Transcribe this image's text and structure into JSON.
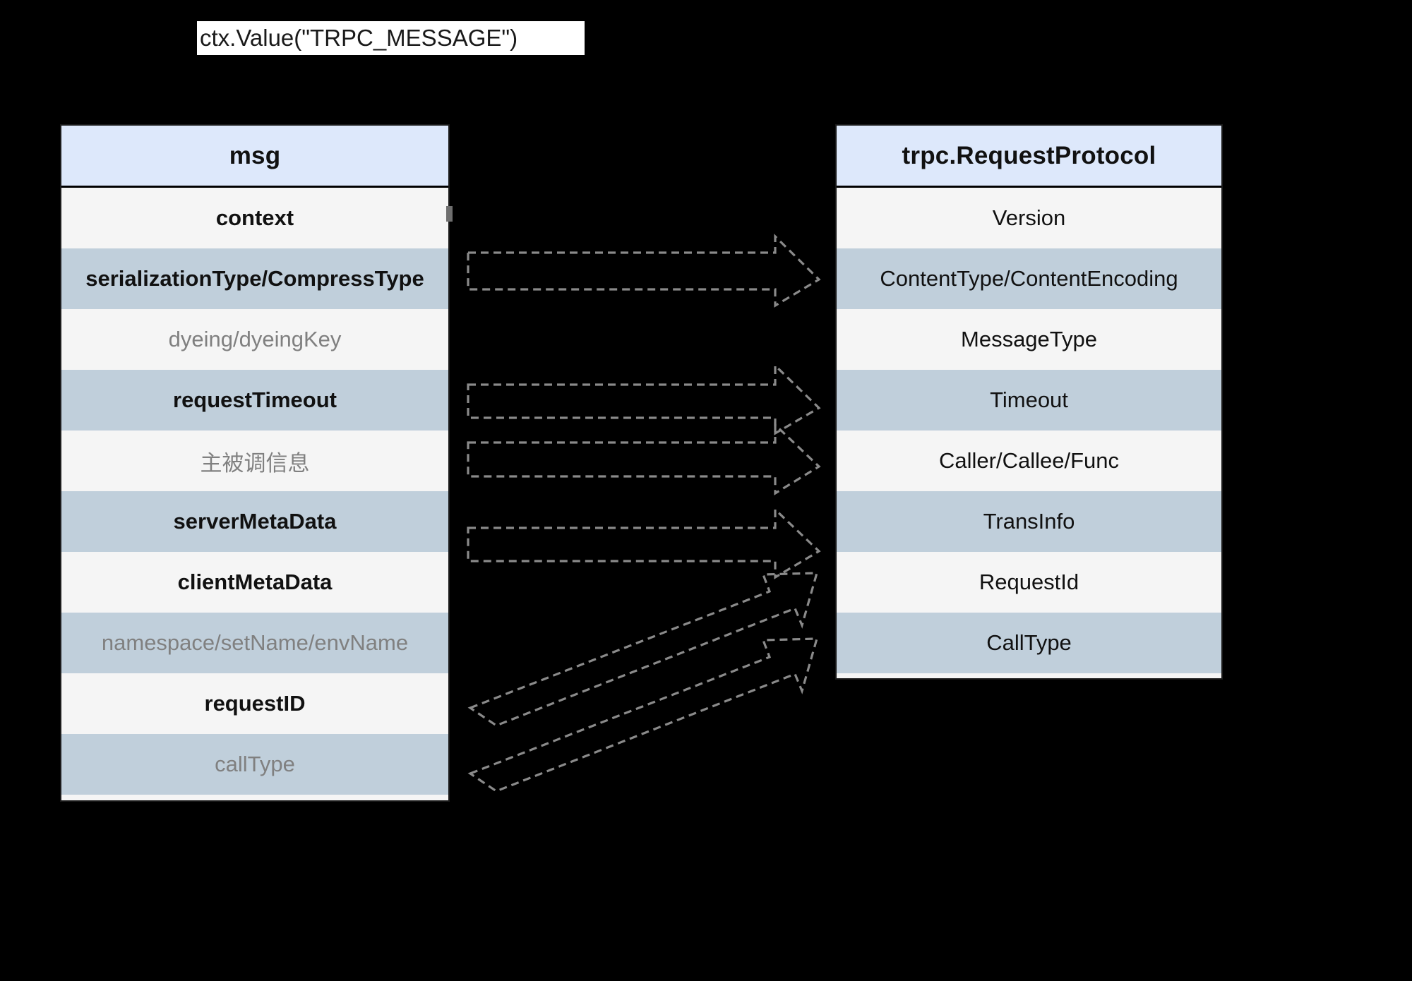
{
  "annotation": {
    "label": "ctx.Value(\"TRPC_MESSAGE\")",
    "connector_icon": "vertical-connector-line"
  },
  "colors": {
    "background": "#000000",
    "header_fill": "#dde8fb",
    "row_light": "#f5f5f5",
    "row_dark": "#c0cfdb",
    "text_strong": "#111111",
    "text_muted": "#808080",
    "border": "#1a1a1a",
    "arrow_stroke": "#8a8a8a"
  },
  "left_table": {
    "title": "msg",
    "rows": [
      {
        "label": "context",
        "emphasis": "strong",
        "shade": "light"
      },
      {
        "label": "serializationType/CompressType",
        "emphasis": "strong",
        "shade": "dark"
      },
      {
        "label": "dyeing/dyeingKey",
        "emphasis": "muted",
        "shade": "light"
      },
      {
        "label": "requestTimeout",
        "emphasis": "strong",
        "shade": "dark"
      },
      {
        "label": "主被调信息",
        "emphasis": "muted",
        "shade": "light"
      },
      {
        "label": "serverMetaData",
        "emphasis": "strong",
        "shade": "dark"
      },
      {
        "label": "clientMetaData",
        "emphasis": "strong",
        "shade": "light"
      },
      {
        "label": "namespace/setName/envName",
        "emphasis": "muted",
        "shade": "dark"
      },
      {
        "label": "requestID",
        "emphasis": "strong",
        "shade": "light"
      },
      {
        "label": "callType",
        "emphasis": "muted",
        "shade": "dark"
      }
    ]
  },
  "right_table": {
    "title": "trpc.RequestProtocol",
    "rows": [
      {
        "label": "Version",
        "emphasis": "plain",
        "shade": "light"
      },
      {
        "label": "ContentType/ContentEncoding",
        "emphasis": "plain",
        "shade": "dark"
      },
      {
        "label": "MessageType",
        "emphasis": "plain",
        "shade": "light"
      },
      {
        "label": "Timeout",
        "emphasis": "plain",
        "shade": "dark"
      },
      {
        "label": "Caller/Callee/Func",
        "emphasis": "plain",
        "shade": "light"
      },
      {
        "label": "TransInfo",
        "emphasis": "plain",
        "shade": "dark"
      },
      {
        "label": "RequestId",
        "emphasis": "plain",
        "shade": "light"
      },
      {
        "label": "CallType",
        "emphasis": "plain",
        "shade": "dark"
      }
    ]
  },
  "mappings": [
    {
      "id": "arrow-serialization-to-contenttype",
      "from": "serializationType/CompressType",
      "to": "ContentType/ContentEncoding"
    },
    {
      "id": "arrow-requesttimeout-to-timeout",
      "from": "requestTimeout",
      "to": "Timeout"
    },
    {
      "id": "arrow-callerinfo-to-callercallee",
      "from": "主被调信息",
      "to": "Caller/Callee/Func"
    },
    {
      "id": "arrow-metadata-to-transinfo",
      "from": "serverMetaData / clientMetaData",
      "to": "TransInfo"
    },
    {
      "id": "arrow-requestid-to-requestid",
      "from": "requestID",
      "to": "RequestId"
    },
    {
      "id": "arrow-calltype-to-calltype",
      "from": "callType",
      "to": "CallType"
    }
  ]
}
